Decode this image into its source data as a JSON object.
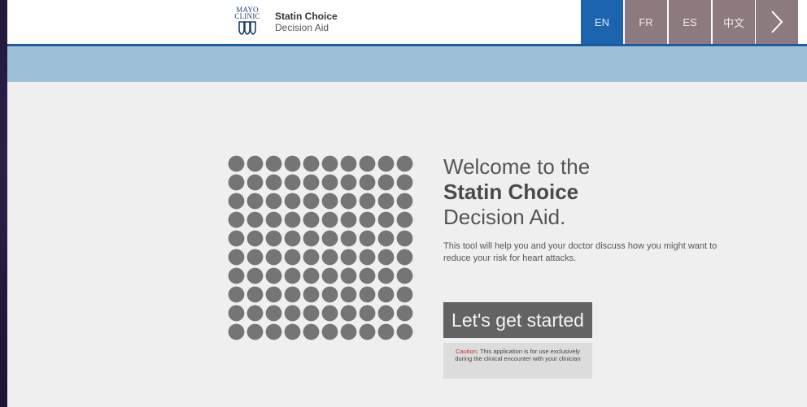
{
  "header": {
    "logo_text": [
      "MAYO",
      "CLINIC"
    ],
    "app_title": "Statin Choice",
    "app_subtitle": "Decision Aid",
    "languages": [
      {
        "code": "EN",
        "active": true
      },
      {
        "code": "FR",
        "active": false
      },
      {
        "code": "ES",
        "active": false
      },
      {
        "code": "中文",
        "active": false
      }
    ],
    "next_icon": "chevron-right-icon"
  },
  "colors": {
    "active_language": "#1d64b0",
    "inactive_language": "#8c7a7f",
    "header_rule": "#1f5aa0",
    "blue_bar": "#9ec1d8",
    "dot": "#757575",
    "caution_word": "#d2292b"
  },
  "main": {
    "welcome_line1": "Welcome to the",
    "welcome_line2": "Statin Choice",
    "welcome_line3": "Decision Aid.",
    "description": "This tool will help you and your doctor discuss how you might want to reduce your risk for heart attacks.",
    "start_button": "Let's get started",
    "caution_label": "Caution:",
    "caution_text": " This application is for use exclusively during the clinical encounter with your clinician",
    "dot_grid": {
      "rows": 10,
      "cols": 10,
      "icon": "person-dot-icon"
    }
  }
}
